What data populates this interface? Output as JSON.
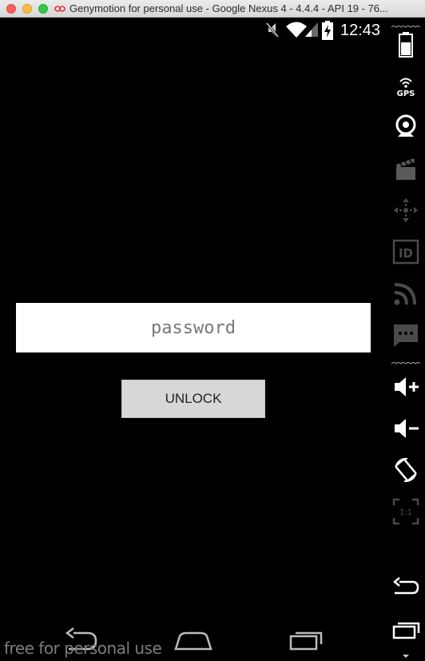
{
  "window": {
    "title": "Genymotion for personal use - Google Nexus 4 - 4.4.4 - API 19 - 76..."
  },
  "status_bar": {
    "time": "12:43",
    "icons": [
      "mute-icon",
      "wifi-icon",
      "cell-signal-icon",
      "battery-charging-icon"
    ]
  },
  "lock_screen": {
    "password_placeholder": "password",
    "password_value": "",
    "unlock_label": "UNLOCK"
  },
  "nav_bar": {
    "buttons": [
      "back-icon",
      "home-icon",
      "recents-icon"
    ]
  },
  "watermark": "free for personal use",
  "toolbar": {
    "tools": [
      "battery-tool",
      "gps-tool",
      "camera-tool",
      "capture-tool",
      "remote-control-tool",
      "device-id-tool",
      "rss-tool",
      "sms-tool",
      "volume-up-tool",
      "volume-down-tool",
      "rotate-tool",
      "pixel-perfect-tool",
      "back-tool",
      "recents-tool"
    ],
    "gps_label": "GPS",
    "id_label": "ID",
    "pixel_label": "1:1"
  }
}
